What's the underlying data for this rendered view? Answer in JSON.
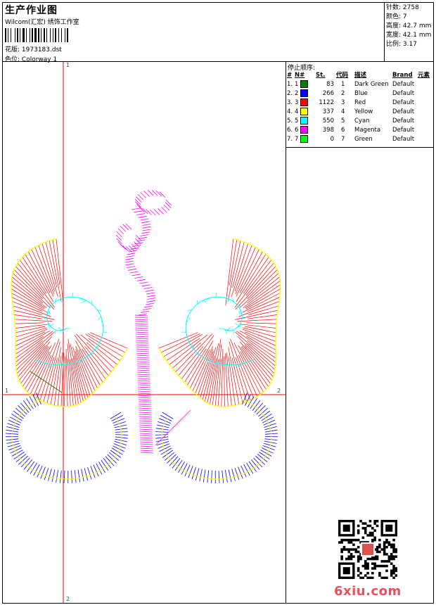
{
  "header": {
    "title": "生产作业图",
    "company": "Wilcom(汇宏) 绣饰工作室",
    "design_label": "花版:",
    "design_value": "1973183.dst",
    "colorway_label": "色位:",
    "colorway_value": "Colorway 1"
  },
  "specs": {
    "stitches_label": "针数:",
    "stitches": "2758",
    "colors_label": "颜色:",
    "colors": "7",
    "height_label": "高度:",
    "height": "42.7 mm",
    "width_label": "宽度:",
    "width": "42.1 mm",
    "scale_label": "比例:",
    "scale": "3.17"
  },
  "stop_sequence": {
    "title": "停止顺序:",
    "headers": [
      "#",
      "N#",
      "St.",
      "代码",
      "描述",
      "Brand",
      "元素"
    ],
    "rows": [
      {
        "n": "1.",
        "nn": "1",
        "color": "#008000",
        "st": "83",
        "code": "1",
        "desc": "Dark Green",
        "brand": "Default"
      },
      {
        "n": "2.",
        "nn": "2",
        "color": "#0000ff",
        "st": "266",
        "code": "2",
        "desc": "Blue",
        "brand": "Default"
      },
      {
        "n": "3.",
        "nn": "3",
        "color": "#ff0000",
        "st": "1122",
        "code": "3",
        "desc": "Red",
        "brand": "Default"
      },
      {
        "n": "4.",
        "nn": "4",
        "color": "#ffff00",
        "st": "337",
        "code": "4",
        "desc": "Yellow",
        "brand": "Default"
      },
      {
        "n": "5.",
        "nn": "5",
        "color": "#00ffff",
        "st": "550",
        "code": "5",
        "desc": "Cyan",
        "brand": "Default"
      },
      {
        "n": "6.",
        "nn": "6",
        "color": "#ff00ff",
        "st": "398",
        "code": "6",
        "desc": "Magenta",
        "brand": "Default"
      },
      {
        "n": "7.",
        "nn": "7",
        "color": "#00ff00",
        "st": "0",
        "code": "7",
        "desc": "Green",
        "brand": "Default"
      }
    ]
  },
  "axis_labels": {
    "top": "1",
    "bottom": "2",
    "left": "1",
    "right": "2"
  },
  "watermark": "6xiu.com",
  "colors": {
    "axis": "#ff0000",
    "red": "#ff0000",
    "blue": "#0000ff",
    "cyan": "#00ffff",
    "magenta": "#ff00ff",
    "yellow": "#ffff00",
    "green": "#008000"
  }
}
